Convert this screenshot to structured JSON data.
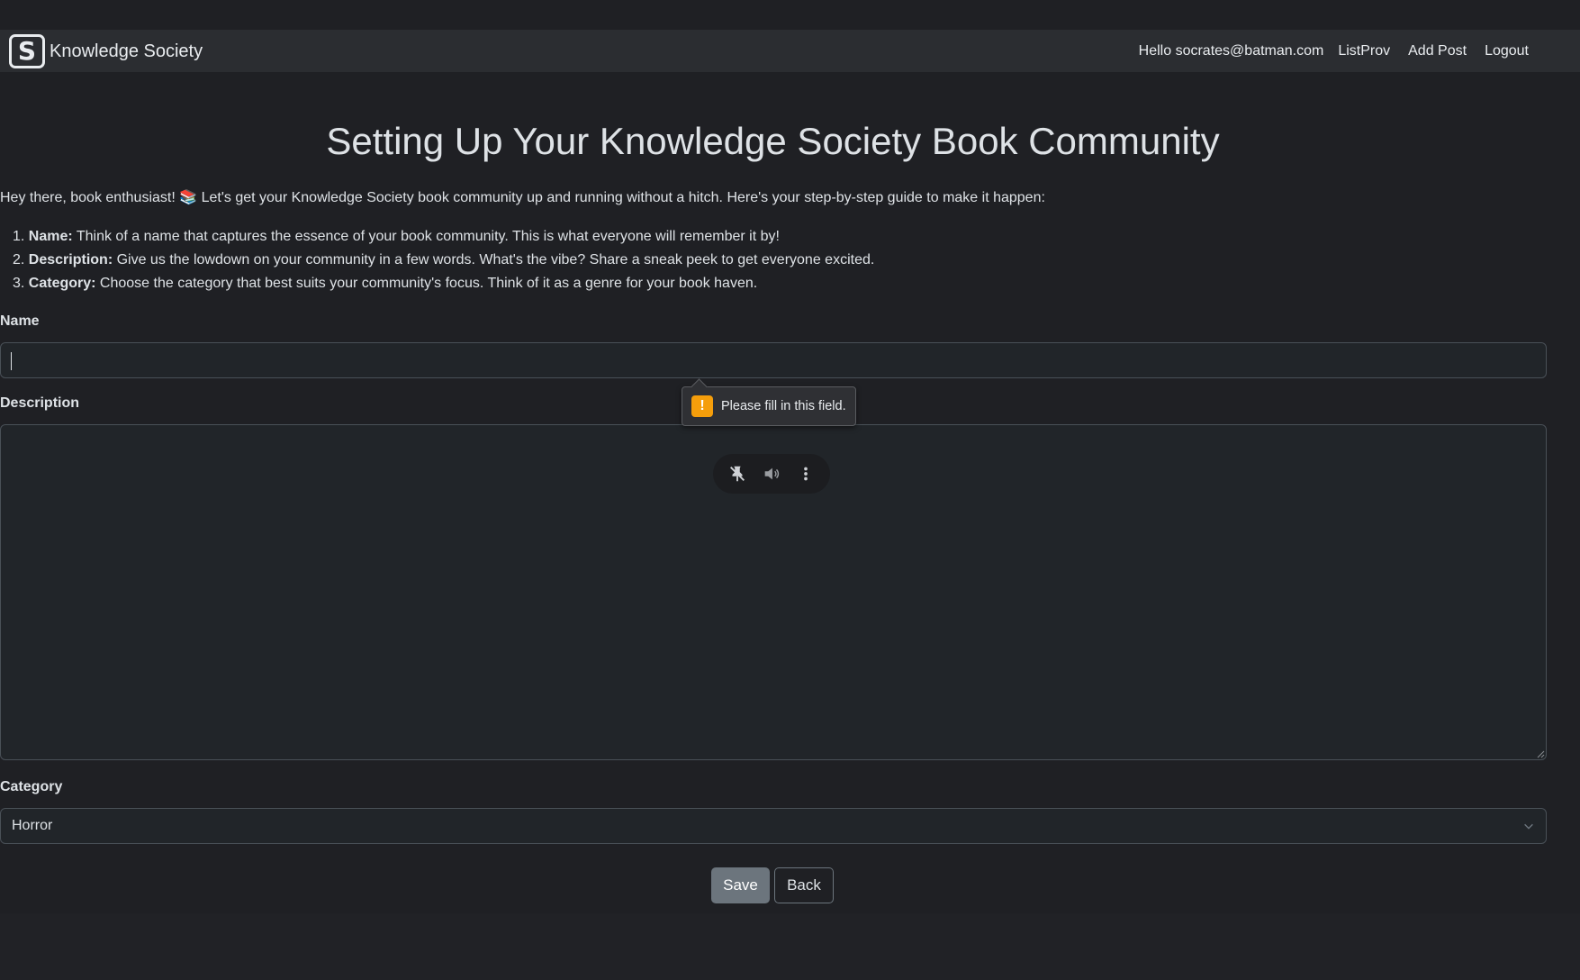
{
  "navbar": {
    "brand_logo": "S",
    "brand_name": "Knowledge Society",
    "greeting": "Hello socrates@batman.com",
    "links": [
      "ListProv",
      "Add Post",
      "Logout"
    ]
  },
  "page": {
    "title": "Setting Up Your Knowledge Society Book Community",
    "intro_before_emoji": "Hey there, book enthusiast! ",
    "emoji": "📚",
    "intro_after_emoji": " Let's get your Knowledge Society book community up and running without a hitch. Here's your step-by-step guide to make it happen:",
    "steps": [
      {
        "num": "1.",
        "label": "Name:",
        "text": " Think of a name that captures the essence of your book community. This is what everyone will remember it by!"
      },
      {
        "num": "2.",
        "label": "Description:",
        "text": " Give us the lowdown on your community in a few words. What's the vibe? Share a sneak peek to get everyone excited."
      },
      {
        "num": "3.",
        "label": "Category:",
        "text": " Choose the category that best suits your community's focus. Think of it as a genre for your book haven."
      }
    ]
  },
  "form": {
    "name_label": "Name",
    "name_value": "",
    "description_label": "Description",
    "description_value": "",
    "category_label": "Category",
    "category_selected": "Horror",
    "validation_message": "Please fill in this field.",
    "save_label": "Save",
    "back_label": "Back"
  },
  "icons": {
    "logo": "bracket-s-logo-icon",
    "warning": "warning-exclamation-icon",
    "pin": "unpin-icon",
    "volume": "volume-icon",
    "more": "more-vertical-icon",
    "chevron": "chevron-down-icon"
  },
  "colors": {
    "background": "#1f2024",
    "navbar": "#2b2d31",
    "warning": "#f59e0b",
    "save_button": "#6c757d"
  }
}
